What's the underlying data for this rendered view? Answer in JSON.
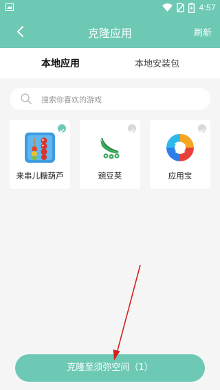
{
  "status_bar": {
    "time": "4:57"
  },
  "header": {
    "title": "克隆应用",
    "refresh_label": "刷新"
  },
  "tabs": [
    {
      "label": "本地应用",
      "active": true
    },
    {
      "label": "本地安装包",
      "active": false
    }
  ],
  "search": {
    "placeholder": "搜索你喜欢的游戏"
  },
  "apps": [
    {
      "name": "来串儿糖葫芦",
      "selected": true,
      "icon": "candied-haws-game-icon"
    },
    {
      "name": "豌豆荚",
      "selected": false,
      "icon": "wandoujia-icon"
    },
    {
      "name": "应用宝",
      "selected": false,
      "icon": "yingyongbao-icon"
    }
  ],
  "bottom_button": {
    "label": "克隆至须弥空间（1）"
  },
  "colors": {
    "accent": "#6dc9b4",
    "annotation_arrow": "#d42020"
  }
}
